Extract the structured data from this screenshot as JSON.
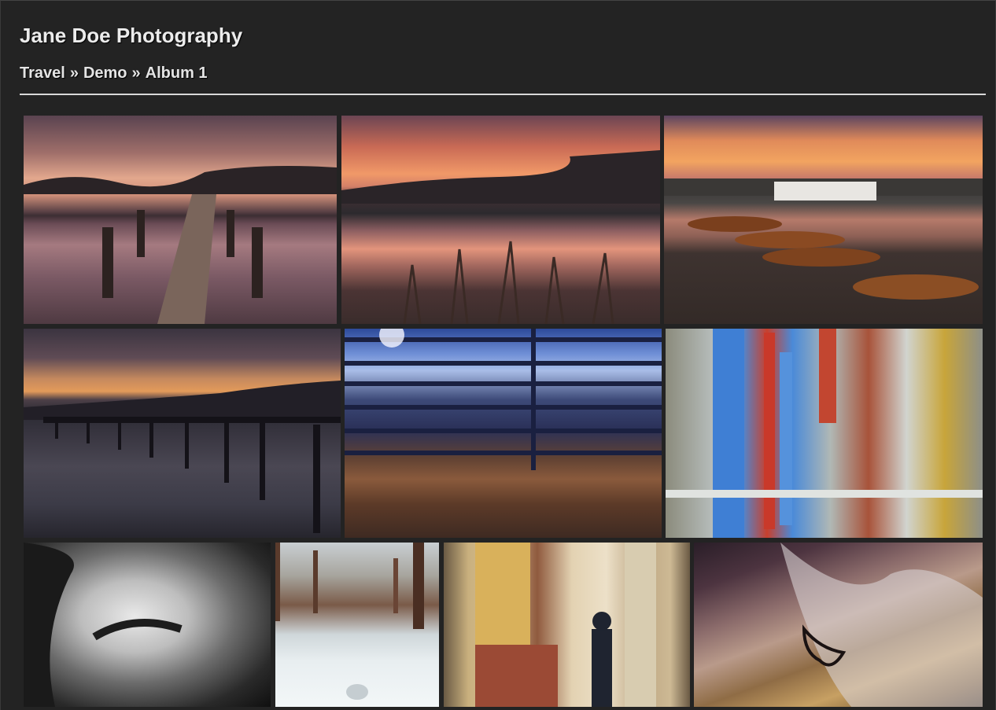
{
  "site": {
    "title": "Jane Doe Photography"
  },
  "breadcrumb": {
    "items": [
      "Travel",
      "Demo",
      "Album 1"
    ],
    "separator": "»"
  },
  "gallery": {
    "photos": [
      {
        "subject": "wooden pier at sunset"
      },
      {
        "subject": "lake sunset with reeds"
      },
      {
        "subject": "rowing boats on shore"
      },
      {
        "subject": "long jetty at dusk"
      },
      {
        "subject": "promenade through railing"
      },
      {
        "subject": "clothespins on line"
      },
      {
        "subject": "cat close-up black and white"
      },
      {
        "subject": "snowy path with trees"
      },
      {
        "subject": "man under arches reading tablet"
      },
      {
        "subject": "heart pendant necklace"
      }
    ]
  },
  "colors": {
    "background": "#232323",
    "text": "#ececec",
    "rule": "#d8d8d8"
  }
}
